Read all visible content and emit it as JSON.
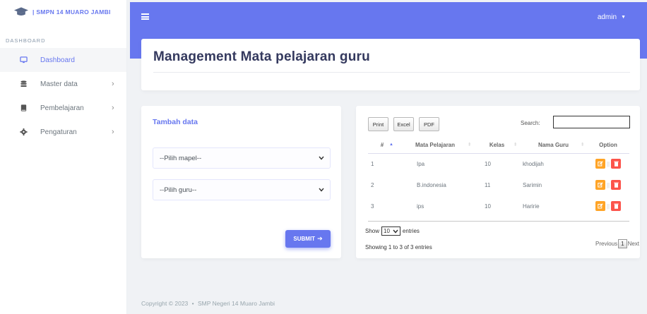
{
  "brand": {
    "name": "| SMPN 14 MUARO JAMBI",
    "logo_icon": "graduation-cap-icon"
  },
  "sidebar": {
    "section": "DASHBOARD",
    "items": [
      {
        "label": "Dashboard",
        "icon": "monitor-icon",
        "active": true
      },
      {
        "label": "Master data",
        "icon": "database-icon"
      },
      {
        "label": "Pembelajaran",
        "icon": "book-icon"
      },
      {
        "label": "Pengaturan",
        "icon": "gear-icon"
      }
    ]
  },
  "topbar": {
    "user": "admin"
  },
  "page": {
    "title": "Management Mata pelajaran guru"
  },
  "form": {
    "title": "Tambah data",
    "mapel_select": "--Pilih mapel--",
    "guru_select": "--Pilih guru--",
    "submit": "SUBMIT"
  },
  "table": {
    "buttons": {
      "print": "Print",
      "excel": "Excel",
      "pdf": "PDF"
    },
    "search_label": "Search:",
    "columns": [
      "#",
      "Mata Pelajaran",
      "Kelas",
      "Nama Guru",
      "Option"
    ],
    "rows": [
      {
        "no": "1",
        "mapel": "Ipa",
        "kelas": "10",
        "guru": "khodijah"
      },
      {
        "no": "2",
        "mapel": "B.indonesia",
        "kelas": "11",
        "guru": "Sarimin"
      },
      {
        "no": "3",
        "mapel": "ips",
        "kelas": "10",
        "guru": "Haririe"
      }
    ],
    "length": {
      "show": "Show",
      "value": "10",
      "entries": "entries"
    },
    "info": "Showing 1 to 3 of 3 entries",
    "pager": {
      "previous": "Previous",
      "current": "1",
      "next": "Next"
    }
  },
  "footer": {
    "copyright": "Copyright © 2023",
    "bullet": "•",
    "org": "SMP Negeri 14 Muaro Jambi"
  },
  "colors": {
    "primary": "#6777ef",
    "warning": "#ffa426",
    "danger": "#fc544b"
  }
}
